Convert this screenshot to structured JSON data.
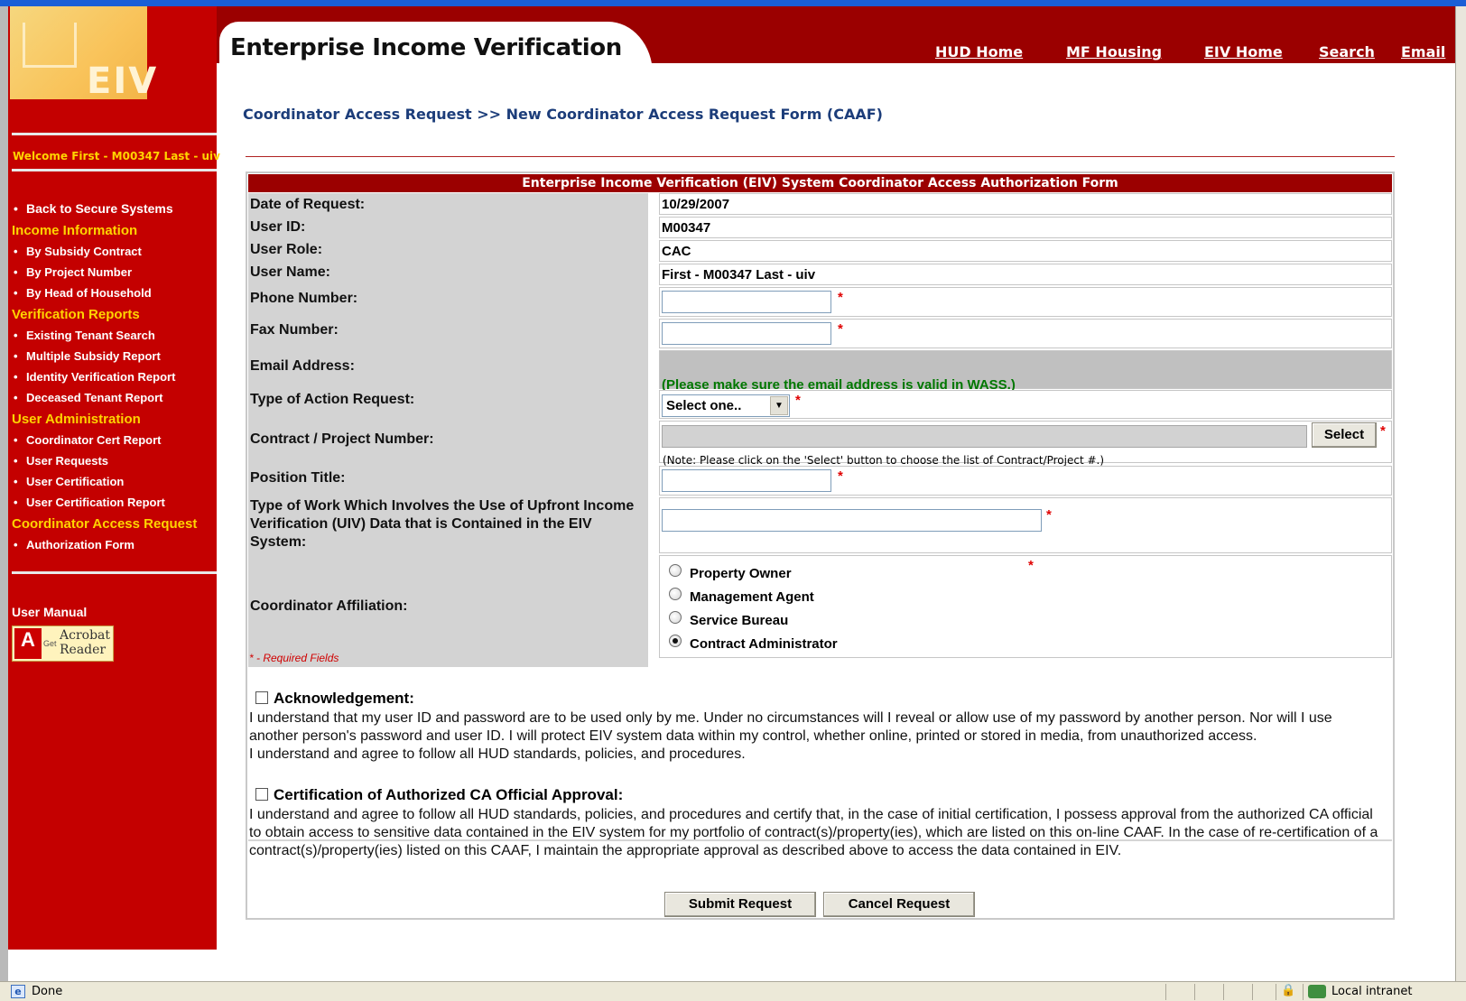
{
  "window": {
    "status": "Done",
    "zone": "Local intranet"
  },
  "header": {
    "title": "Enterprise Income Verification",
    "links": [
      "HUD Home",
      "MF Housing",
      "EIV Home",
      "Search",
      "Email"
    ]
  },
  "sidebar": {
    "logo_text": "EIV",
    "welcome": "Welcome First - M00347 Last - uiv",
    "back": "Back to Secure Systems",
    "sections": [
      {
        "title": "Income Information",
        "items": [
          "By Subsidy Contract",
          "By Project Number",
          "By Head of Household"
        ]
      },
      {
        "title": "Verification Reports",
        "items": [
          "Existing Tenant Search",
          "Multiple Subsidy Report",
          "Identity Verification Report",
          "Deceased Tenant Report"
        ]
      },
      {
        "title": "User Administration",
        "items": [
          "Coordinator Cert Report",
          "User Requests",
          "User Certification",
          "User Certification Report"
        ]
      },
      {
        "title": "Coordinator Access Request",
        "items": [
          "Authorization Form"
        ]
      }
    ],
    "user_manual": "User Manual",
    "acrobat": {
      "get": "Get",
      "line1": "Acrobat",
      "line2": "Reader",
      "brand": "Adobe"
    }
  },
  "breadcrumb": "Coordinator Access Request >> New Coordinator Access Request Form (CAAF)",
  "form": {
    "title": "Enterprise Income Verification (EIV) System Coordinator Access Authorization Form",
    "labels": {
      "date": "Date of Request:",
      "user_id": "User ID:",
      "user_role": "User Role:",
      "user_name": "User Name:",
      "phone": "Phone Number:",
      "fax": "Fax Number:",
      "email": "Email Address:",
      "action": "Type of Action Request:",
      "contract": "Contract / Project Number:",
      "position": "Position Title:",
      "work_type": "Type of Work Which Involves the Use of Upfront Income Verification (UIV) Data that is Contained in the EIV System:",
      "affiliation": "Coordinator Affiliation:"
    },
    "values": {
      "date": "10/29/2007",
      "user_id": "M00347",
      "user_role": "CAC",
      "user_name": "First - M00347 Last - uiv",
      "phone": "",
      "fax": "",
      "position": "",
      "work_type": ""
    },
    "required_mark": "*",
    "email_note": "(Please make sure the email address is valid in WASS.)",
    "action_select": "Select one..",
    "contract_select_button": "Select",
    "contract_note": "(Note: Please click on the 'Select' button to choose the list of Contract/Project #.)",
    "affiliation_options": [
      {
        "label": "Property Owner",
        "selected": false
      },
      {
        "label": "Management Agent",
        "selected": false
      },
      {
        "label": "Service Bureau",
        "selected": false
      },
      {
        "label": "Contract Administrator",
        "selected": true
      }
    ],
    "required_note": "* - Required Fields",
    "acknowledgement": {
      "title": "Acknowledgement:",
      "checked": false,
      "text": "I understand that my user ID and password are to be used only by me. Under no circumstances will I reveal or allow use of my password by another person. Nor will I use another person's password and user ID. I will protect EIV system data within my control, whether online, printed or stored in media, from unauthorized access.\nI understand and agree to follow all HUD standards, policies, and procedures."
    },
    "certification": {
      "title": "Certification of Authorized CA Official Approval:",
      "checked": false,
      "text": "I understand and agree to follow all HUD standards, policies, and procedures and certify that, in the case of initial certification, I possess approval from the authorized CA official to obtain access to sensitive data contained in the EIV system for my portfolio of contract(s)/property(ies), which are listed on this on-line CAAF. In the case of re-certification of a contract(s)/property(ies) listed on this CAAF, I maintain the appropriate approval as described above to access the data contained in EIV."
    },
    "submit": "Submit Request",
    "cancel": "Cancel Request"
  },
  "colors": {
    "nav_red": "#c40000",
    "header_red": "#9b0000",
    "accent_yellow": "#ffd400",
    "link_blue": "#1c3d7a",
    "note_green": "#007700"
  }
}
